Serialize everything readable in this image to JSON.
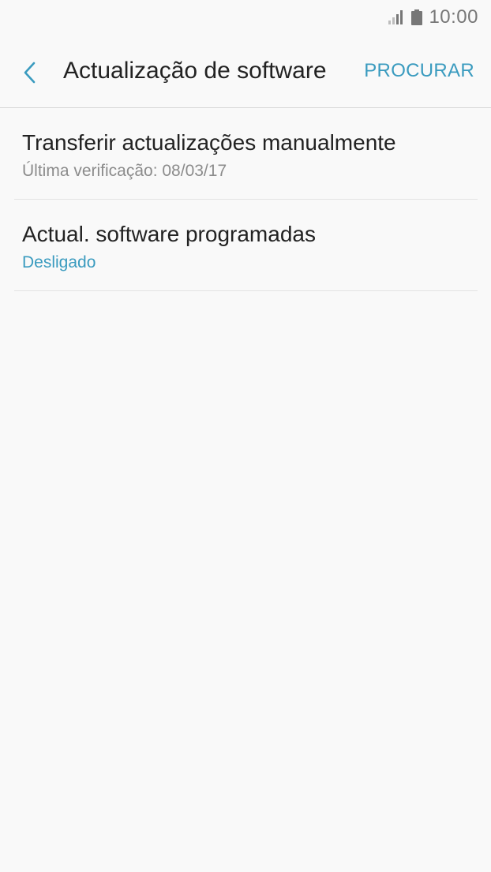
{
  "status_bar": {
    "time": "10:00",
    "icons": [
      "signal-icon",
      "battery-icon"
    ]
  },
  "app_bar": {
    "back_icon": "chevron-left-icon",
    "title": "Actualização de software",
    "action_label": "PROCURAR"
  },
  "settings": {
    "items": [
      {
        "title": "Transferir actualizações manualmente",
        "subtitle": "Última verificação: 08/03/17"
      },
      {
        "title": "Actual. software programadas",
        "subtitle": "Desligado"
      }
    ]
  },
  "colors": {
    "accent": "#3a9bbf",
    "background": "#f9f9f9",
    "primary_text": "#222222",
    "secondary_text": "#8c8c8c",
    "divider": "#e3e3e3"
  }
}
